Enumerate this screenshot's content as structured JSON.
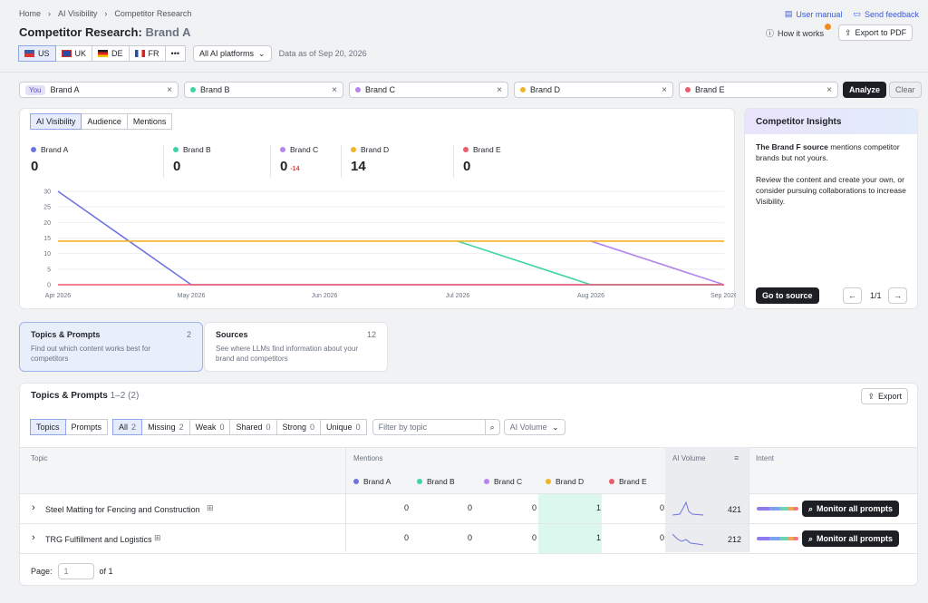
{
  "breadcrumb": {
    "items": [
      "Home",
      "AI Visibility",
      "Competitor Research"
    ]
  },
  "header": {
    "title": "Competitor Research:",
    "brand": "Brand A",
    "user_manual": "User manual",
    "send_feedback": "Send feedback",
    "how_it_works": "How it works",
    "export_pdf": "Export to PDF"
  },
  "countries": [
    {
      "code": "US",
      "active": true
    },
    {
      "code": "UK"
    },
    {
      "code": "DE"
    },
    {
      "code": "FR"
    }
  ],
  "more": "•••",
  "platform_select": "All AI platforms",
  "data_as_of": "Data as of Sep 20, 2026",
  "competitors": {
    "you_badge": "You",
    "items": [
      "Brand A",
      "Brand B",
      "Brand C",
      "Brand D",
      "Brand E"
    ],
    "analyze": "Analyze",
    "clear": "Clear"
  },
  "chart_tabs": [
    "AI Visibility",
    "Audience",
    "Mentions"
  ],
  "colors": {
    "Brand A": "#6f73e0",
    "Brand B": "#3fd3a6",
    "Brand C": "#b884ee",
    "Brand D": "#f0b429",
    "Brand E": "#ee5d6c"
  },
  "metrics": [
    {
      "name": "Brand A",
      "value": "0",
      "delta": ""
    },
    {
      "name": "Brand B",
      "value": "0",
      "delta": ""
    },
    {
      "name": "Brand C",
      "value": "0",
      "delta": "-14"
    },
    {
      "name": "Brand D",
      "value": "14",
      "delta": ""
    },
    {
      "name": "Brand E",
      "value": "0",
      "delta": ""
    }
  ],
  "chart_data": {
    "type": "line",
    "x": [
      "Apr 2026",
      "May 2026",
      "Jun 2026",
      "Jul 2026",
      "Aug 2026",
      "Sep 2026"
    ],
    "ylim": [
      0,
      30
    ],
    "yticks": [
      0,
      5,
      10,
      15,
      20,
      25,
      30
    ],
    "series": [
      {
        "name": "Brand A",
        "values": [
          30,
          0,
          0,
          0,
          0,
          0
        ]
      },
      {
        "name": "Brand B",
        "values": [
          null,
          null,
          null,
          14,
          0,
          0
        ]
      },
      {
        "name": "Brand C",
        "values": [
          null,
          null,
          null,
          null,
          14,
          0
        ]
      },
      {
        "name": "Brand D",
        "values": [
          14,
          14,
          14,
          14,
          14,
          14
        ]
      },
      {
        "name": "Brand E",
        "values": [
          0,
          0,
          0,
          0,
          0,
          0
        ]
      }
    ]
  },
  "insights": {
    "title": "Competitor Insights",
    "bold": "The Brand F source",
    "text1": " mentions competitor brands but not yours.",
    "text2": "Review the content and create your own, or consider pursuing collaborations to increase Visibility.",
    "go": "Go to source",
    "pager": "1/1"
  },
  "cards": [
    {
      "title": "Topics & Prompts",
      "count": "2",
      "desc": "Find out which content works best for competitors"
    },
    {
      "title": "Sources",
      "count": "12",
      "desc": "See where LLMs find information about your brand and competitors"
    }
  ],
  "table": {
    "title": "Topics & Prompts",
    "range": "1–2 (2)",
    "export": "Export",
    "view_tabs": [
      "Topics",
      "Prompts"
    ],
    "filters": [
      {
        "label": "All",
        "count": "2"
      },
      {
        "label": "Missing",
        "count": "2"
      },
      {
        "label": "Weak",
        "count": "0"
      },
      {
        "label": "Shared",
        "count": "0"
      },
      {
        "label": "Strong",
        "count": "0"
      },
      {
        "label": "Unique",
        "count": "0"
      }
    ],
    "search_placeholder": "Filter by topic",
    "volume_select": "AI Volume",
    "headers": {
      "topic": "Topic",
      "mentions": "Mentions",
      "volume": "AI Volume",
      "intent": "Intent"
    },
    "brands": [
      "Brand A",
      "Brand B",
      "Brand C",
      "Brand D",
      "Brand E"
    ],
    "rows": [
      {
        "topic": "Steel Matting for Fencing and Construction",
        "values": [
          "0",
          "0",
          "0",
          "1",
          "0"
        ],
        "volume": "421",
        "action": "Monitor all prompts"
      },
      {
        "topic": "TRG Fulfillment and Logistics",
        "values": [
          "0",
          "0",
          "0",
          "1",
          "0"
        ],
        "volume": "212",
        "action": "Monitor all prompts"
      }
    ],
    "page_label": "Page:",
    "page_value": "1",
    "page_of": "of 1"
  }
}
